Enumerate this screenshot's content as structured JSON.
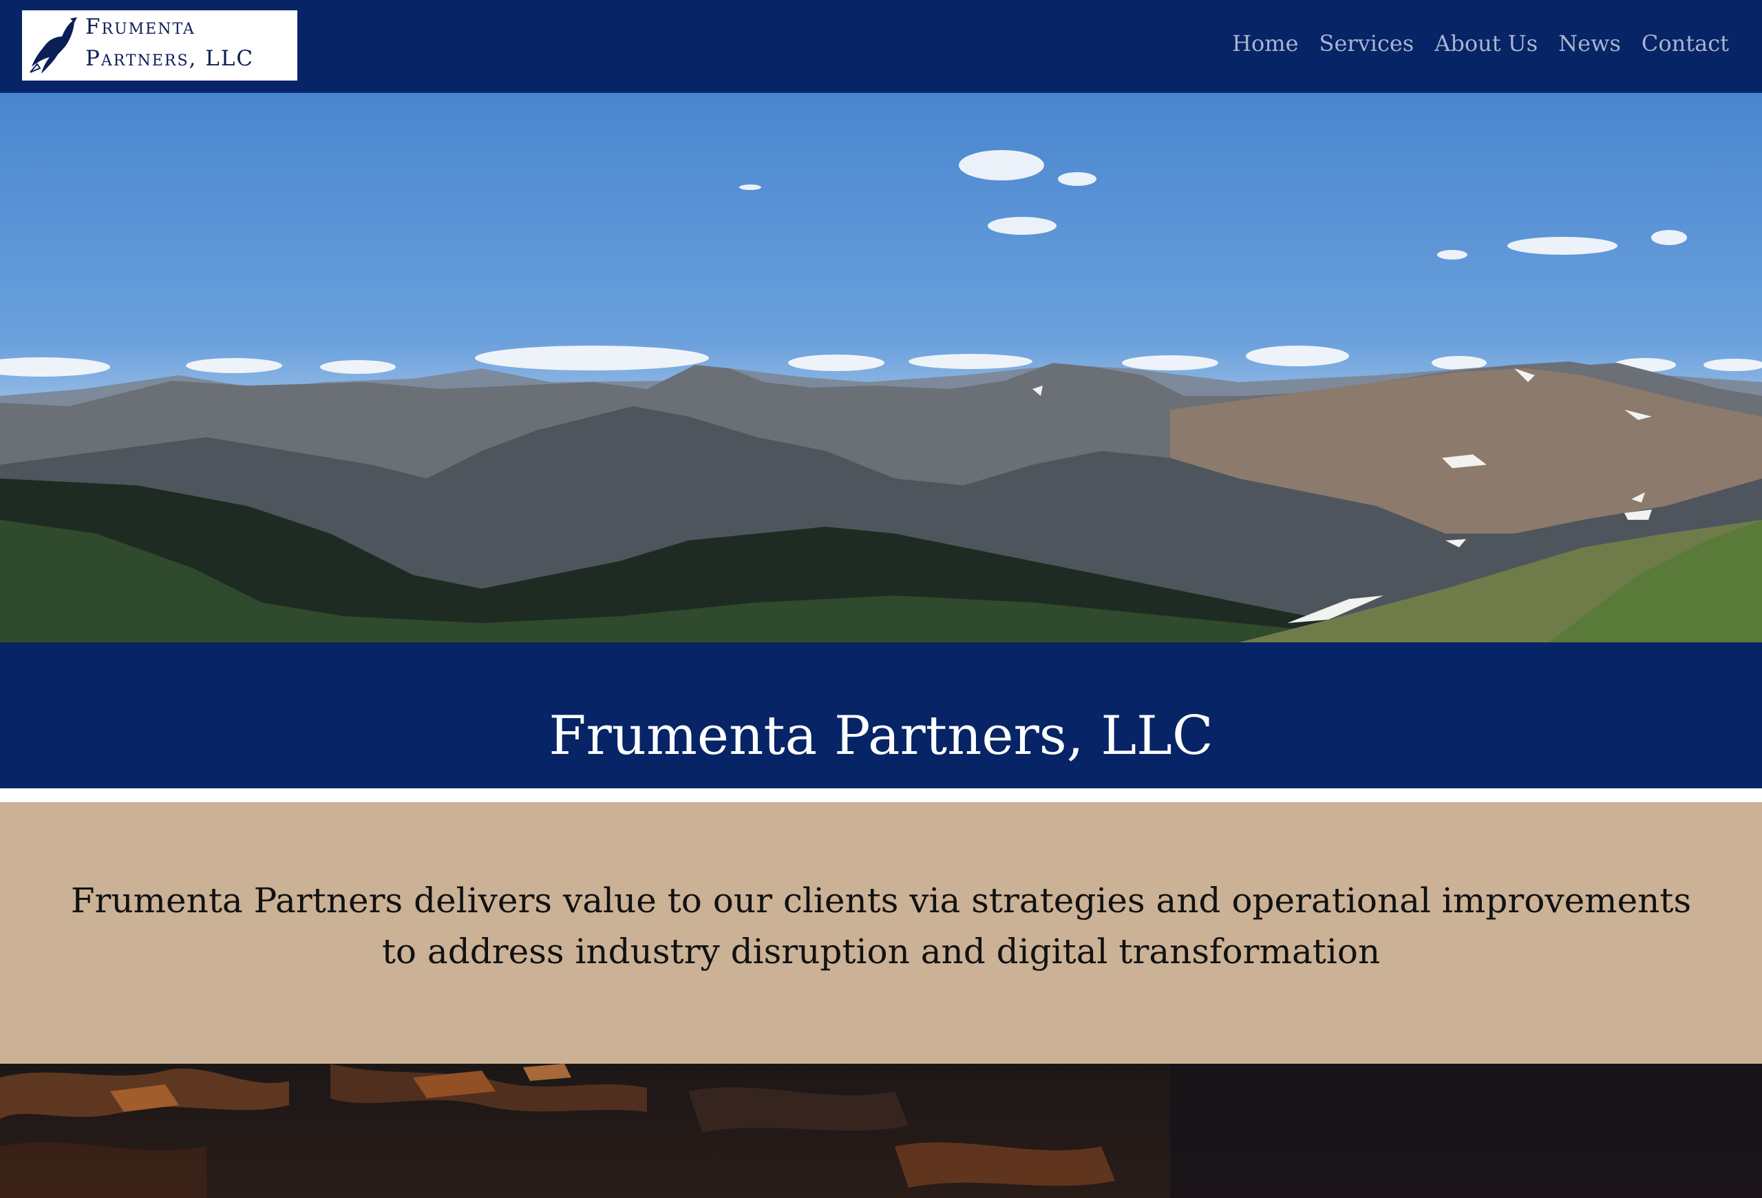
{
  "header": {
    "logo": {
      "line1": "Frumenta",
      "line2": "Partners, LLC",
      "icon": "eagle-icon"
    },
    "nav": [
      "Home",
      "Services",
      "About Us",
      "News",
      "Contact"
    ]
  },
  "hero": {
    "image": "mountain-range-photo"
  },
  "title": "Frumenta Partners, LLC",
  "tagline": "Frumenta Partners delivers value to our clients via strategies and operational improvements to address industry disruption and digital transformation",
  "footer_image": "sunset-clouds-photo",
  "colors": {
    "navy": "#062466",
    "tan": "#cbb195",
    "nav_text": "#a8b4cf",
    "logo_text": "#0b1e55"
  }
}
